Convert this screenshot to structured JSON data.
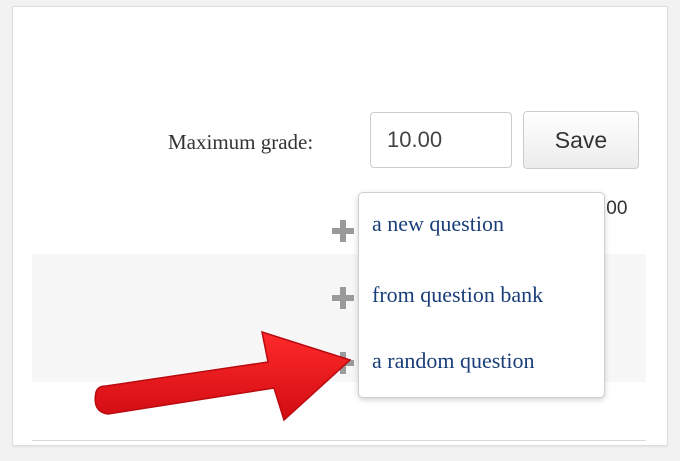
{
  "grade": {
    "label": "Maximum grade:",
    "value": "10.00",
    "save_label": "Save",
    "total_fragment": ".00"
  },
  "add_menu": {
    "items": [
      {
        "label": "a new question",
        "icon": "plus-icon"
      },
      {
        "label": "from question bank",
        "icon": "plus-icon"
      },
      {
        "label": "a random question",
        "icon": "plus-icon"
      }
    ]
  },
  "annotation": {
    "arrow_color": "#e8141b",
    "points_to": "a random question"
  },
  "colors": {
    "menu_link": "#1a3e78",
    "icon_gray": "#9a9a9a",
    "panel_border": "#dcdcdc"
  }
}
